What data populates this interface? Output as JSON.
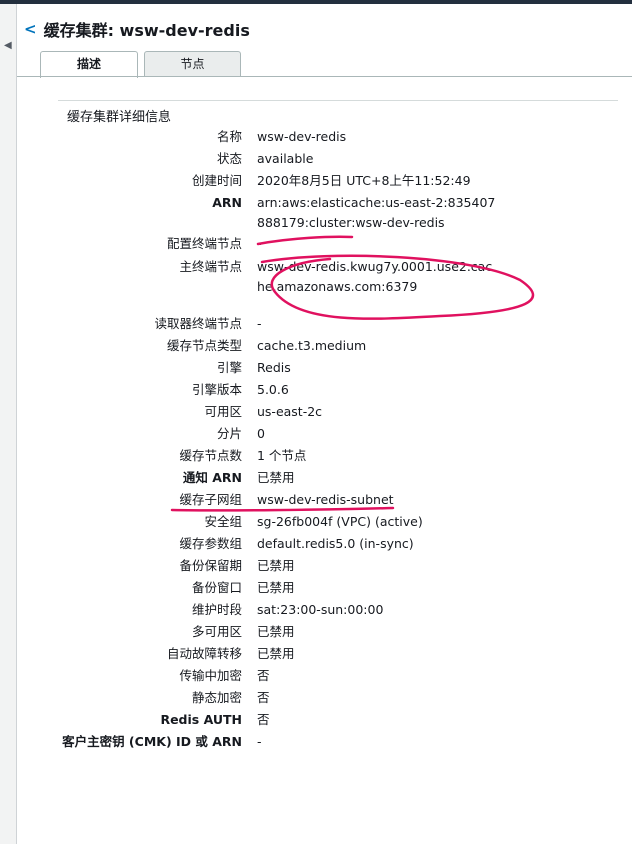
{
  "header": {
    "back_icon": "<",
    "title": "缓存集群: wsw-dev-redis"
  },
  "tabs": [
    {
      "label": "描述",
      "active": true
    },
    {
      "label": "节点",
      "active": false
    }
  ],
  "section": {
    "title": "缓存集群详细信息"
  },
  "details": [
    {
      "label": "名称",
      "value": "wsw-dev-redis"
    },
    {
      "label": "状态",
      "value": "available"
    },
    {
      "label": "创建时间",
      "value": "2020年8月5日 UTC+8上午11:52:49"
    },
    {
      "label": "ARN",
      "value": "arn:aws:elasticache:us-east-2:835407888179:cluster:wsw-dev-redis"
    },
    {
      "label": "配置终端节点",
      "value": "-"
    },
    {
      "label": "主终端节点",
      "value": "wsw-dev-redis.kwug7y.0001.use2.cache.amazonaws.com:6379"
    },
    {
      "label": "读取器终端节点",
      "value": "-"
    },
    {
      "label": "缓存节点类型",
      "value": "cache.t3.medium"
    },
    {
      "label": "引擎",
      "value": "Redis"
    },
    {
      "label": "引擎版本",
      "value": "5.0.6"
    },
    {
      "label": "可用区",
      "value": "us-east-2c"
    },
    {
      "label": "分片",
      "value": "0"
    },
    {
      "label": "缓存节点数",
      "value": "1 个节点"
    },
    {
      "label": "通知 ARN",
      "value": "已禁用"
    },
    {
      "label": "缓存子网组",
      "value": "wsw-dev-redis-subnet"
    },
    {
      "label": "安全组",
      "value": "sg-26fb004f (VPC) (active)"
    },
    {
      "label": "缓存参数组",
      "value": "default.redis5.0 (in-sync)"
    },
    {
      "label": "备份保留期",
      "value": "已禁用"
    },
    {
      "label": "备份窗口",
      "value": "已禁用"
    },
    {
      "label": "维护时段",
      "value": "sat:23:00-sun:00:00"
    },
    {
      "label": "多可用区",
      "value": "已禁用"
    },
    {
      "label": "自动故障转移",
      "value": "已禁用"
    },
    {
      "label": "传输中加密",
      "value": "否"
    },
    {
      "label": "静态加密",
      "value": "否"
    },
    {
      "label": "Redis AUTH",
      "value": "否"
    },
    {
      "label": "客户主密钥 (CMK) ID 或 ARN",
      "value": "-"
    }
  ],
  "colors": {
    "link": "#0073bb",
    "annotation": "#e0115f"
  }
}
